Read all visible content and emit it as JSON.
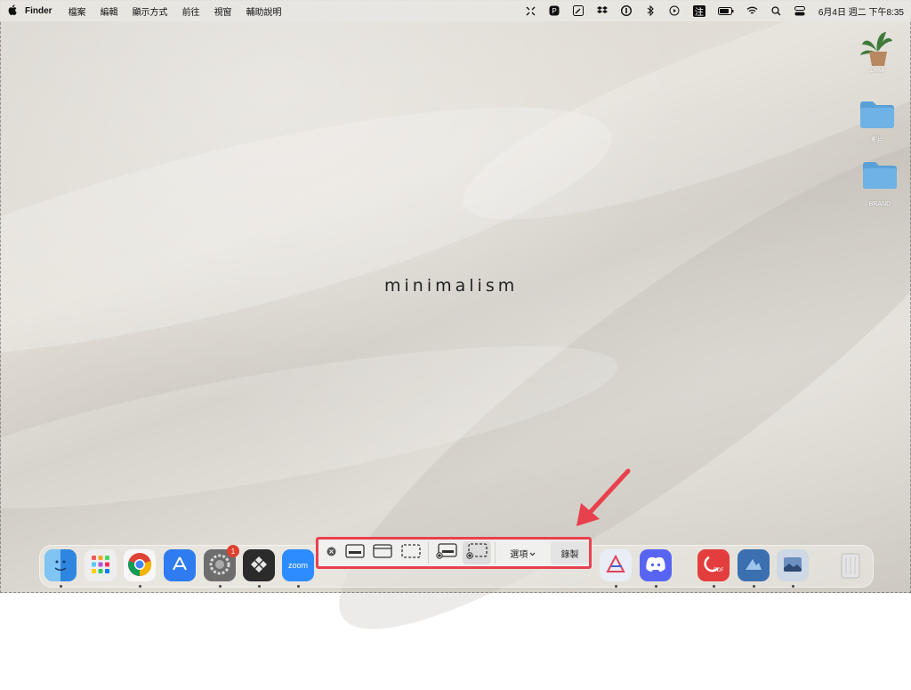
{
  "menubar": {
    "apple": "",
    "items": [
      "Finder",
      "檔案",
      "編輯",
      "顯示方式",
      "前往",
      "視窗",
      "輔助說明"
    ],
    "status_icons": [
      "move-icon",
      "p-icon",
      "pen-icon",
      "dropbox-icon",
      "1password-icon",
      "bluetooth-icon",
      "play-icon",
      "input-method",
      "battery-icon",
      "wifi-icon",
      "search-icon",
      "control-center-icon"
    ],
    "input_method": "注",
    "clock": "6月4日 週二 下午8:35"
  },
  "wallpaper": {
    "wordmark": "minimalism"
  },
  "desktop_icons": [
    {
      "label": "Desk",
      "type": "plant"
    },
    {
      "label": "影片",
      "type": "folder"
    },
    {
      "label": "BRAND",
      "type": "folder"
    }
  ],
  "dock": {
    "apps": [
      {
        "name": "finder",
        "color": "#3a8ee6"
      },
      {
        "name": "launchpad",
        "color": "#e9e9e9"
      },
      {
        "name": "chrome",
        "color": "#ffffff"
      },
      {
        "name": "app-store",
        "color": "#2f7bf0"
      },
      {
        "name": "system-settings",
        "color": "#8a8a8a",
        "badge": "1"
      },
      {
        "name": "setapp",
        "color": "#2b2b2b"
      },
      {
        "name": "zoom",
        "color": "#2d8cff",
        "label": "zoom"
      },
      {
        "name": "affinity",
        "color": "#e9edf5"
      },
      {
        "name": "discord",
        "color": "#5865f2"
      },
      {
        "name": "pdf-expert",
        "color": "#e33d3d"
      },
      {
        "name": "preview",
        "color": "#3a6fb0"
      },
      {
        "name": "photo-app",
        "color": "#cfd8e6"
      },
      {
        "name": "trash",
        "color": "#d8d8d8"
      }
    ]
  },
  "screenshot_toolbar": {
    "options_label": "選項",
    "record_label": "錄製",
    "tools": [
      "capture-screen",
      "capture-window",
      "capture-selection",
      "record-screen",
      "record-selection"
    ],
    "accent": "#e8414e"
  }
}
